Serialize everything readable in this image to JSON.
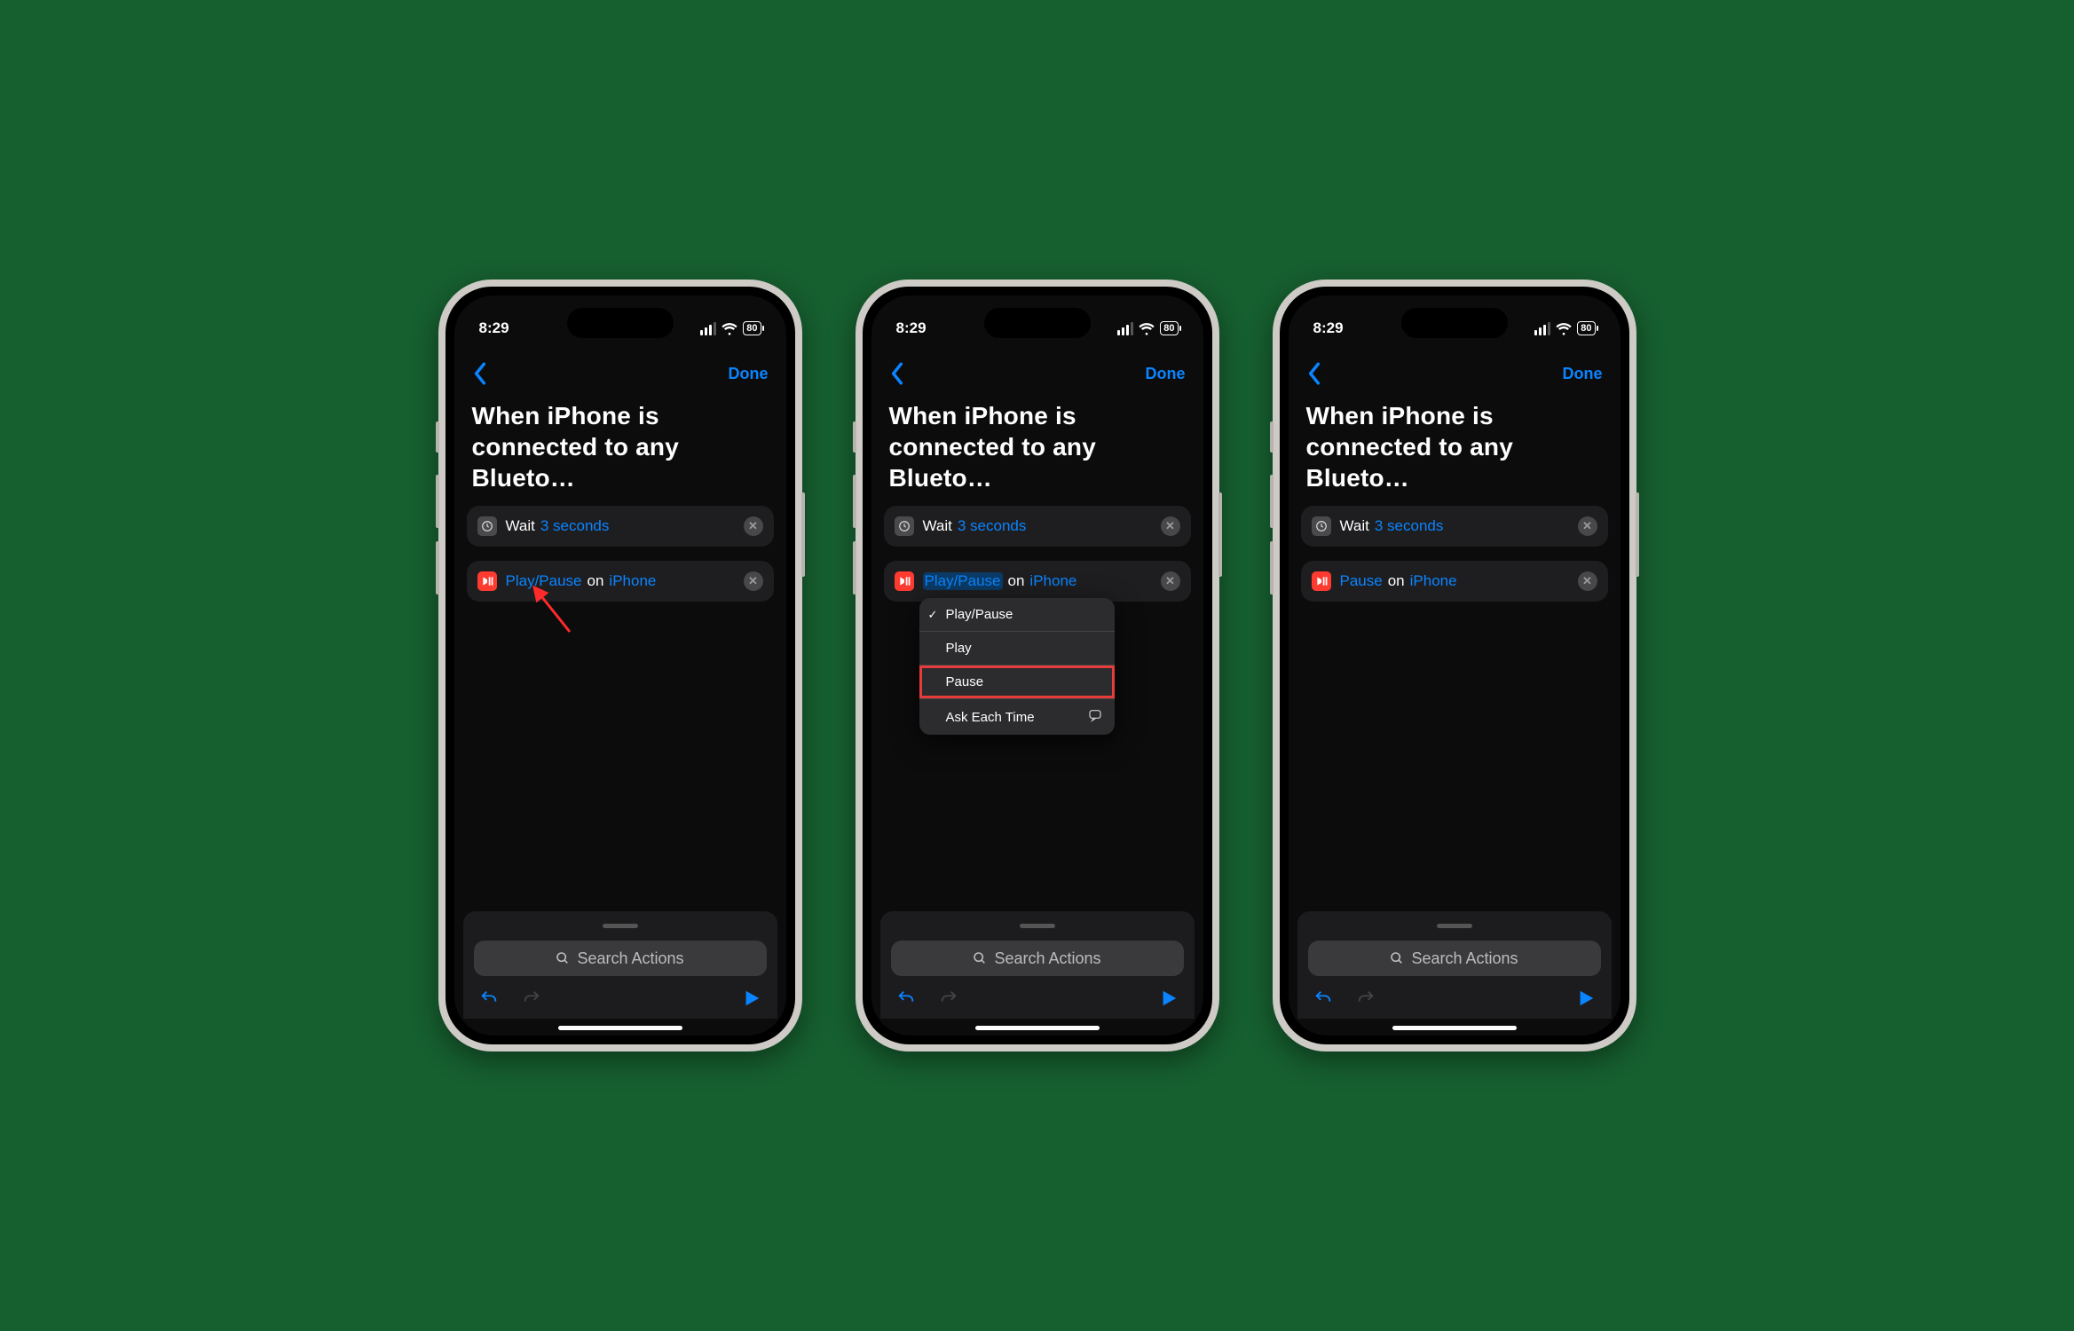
{
  "status": {
    "time": "8:29",
    "battery": "80"
  },
  "nav": {
    "done": "Done"
  },
  "title": "When iPhone is connected to any Blueto…",
  "action_wait": {
    "label": "Wait",
    "param": "3 seconds"
  },
  "action_play": {
    "connector": "on",
    "device": "iPhone"
  },
  "screens": {
    "s1": {
      "play_label": "Play/Pause"
    },
    "s2": {
      "play_label": "Play/Pause"
    },
    "s3": {
      "play_label": "Pause"
    }
  },
  "popover": {
    "opt1": "Play/Pause",
    "opt2": "Play",
    "opt3": "Pause",
    "opt4": "Ask Each Time"
  },
  "search": {
    "placeholder": "Search Actions"
  }
}
